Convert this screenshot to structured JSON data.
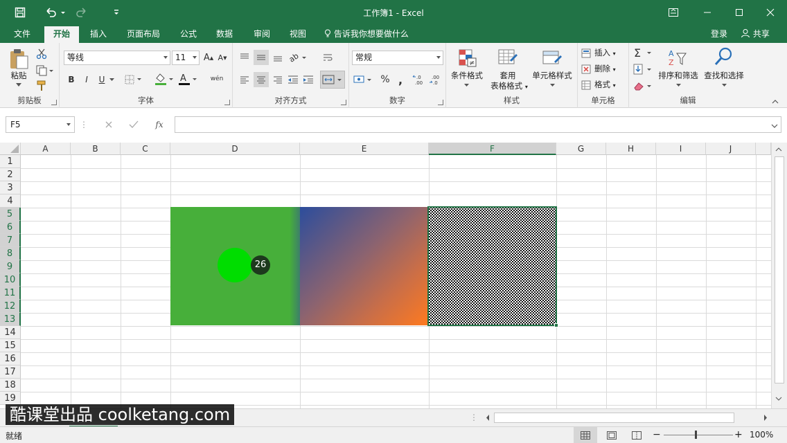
{
  "title": "工作簿1 - Excel",
  "tabs": [
    "文件",
    "开始",
    "插入",
    "页面布局",
    "公式",
    "数据",
    "审阅",
    "视图"
  ],
  "tell_me": "告诉我你想要做什么",
  "login": "登录",
  "share": "共享",
  "ribbon": {
    "clipboard": {
      "paste": "粘贴",
      "label": "剪贴板"
    },
    "font": {
      "name": "等线",
      "size": "11",
      "label": "字体",
      "bold": "B",
      "italic": "I",
      "underline": "U",
      "phonetic": "wén"
    },
    "align": {
      "label": "对齐方式"
    },
    "number": {
      "format": "常规",
      "label": "数字",
      "percent": "%",
      "comma": ","
    },
    "styles": {
      "cond": "条件格式",
      "table1": "套用",
      "table2": "表格格式",
      "cell": "单元格样式",
      "label": "样式"
    },
    "cells": {
      "insert": "插入",
      "delete": "删除",
      "format": "格式",
      "label": "单元格"
    },
    "editing": {
      "sort": "排序和筛选",
      "find": "查找和选择",
      "label": "编辑"
    }
  },
  "formula_bar": {
    "name_box": "F5",
    "fx": "fx",
    "value": ""
  },
  "columns": [
    "A",
    "B",
    "C",
    "D",
    "E",
    "F",
    "G",
    "H",
    "I",
    "J"
  ],
  "rows": [
    "1",
    "2",
    "3",
    "4",
    "5",
    "6",
    "7",
    "8",
    "9",
    "10",
    "11",
    "12",
    "13",
    "14",
    "15",
    "16",
    "17",
    "18",
    "19"
  ],
  "selected_cell": "F5",
  "click_badge": "26",
  "watermark": "酷课堂出品 coolketang.com",
  "status": {
    "ready": "就绪",
    "zoom": "100%"
  },
  "colors": {
    "accent": "#217346",
    "green_fill": "#47af3a",
    "gradient_start": "#2c4d9c",
    "gradient_end": "#ff7a1f"
  }
}
